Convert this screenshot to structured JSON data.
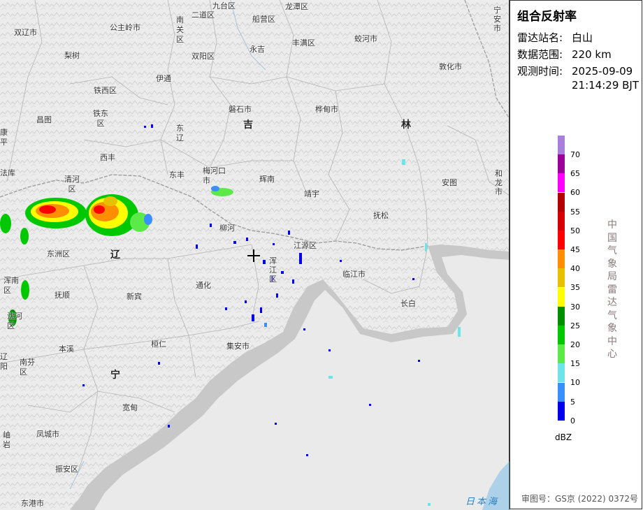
{
  "panel": {
    "title": "组合反射率",
    "station_label": "雷达站名:",
    "station_value": "白山",
    "range_label": "数据范围:",
    "range_value": "220 km",
    "time_label": "观测时间:",
    "time_value_date": "2025-09-09",
    "time_value_clock": "21:14:29 BJT",
    "unit": "dBZ",
    "agency_chars": [
      "中",
      "国",
      "气",
      "象",
      "局",
      "雷",
      "达",
      "气",
      "象",
      "中",
      "心"
    ],
    "approval": "审图号：GS京 (2022) 0372号"
  },
  "legend": {
    "bins": [
      {
        "label": "70",
        "color": "#a97fdc"
      },
      {
        "label": "65",
        "color": "#9b009b"
      },
      {
        "label": "60",
        "color": "#ff00ff"
      },
      {
        "label": "55",
        "color": "#b30000"
      },
      {
        "label": "50",
        "color": "#d60000"
      },
      {
        "label": "45",
        "color": "#ff0000"
      },
      {
        "label": "40",
        "color": "#ff8f00"
      },
      {
        "label": "35",
        "color": "#e7c000"
      },
      {
        "label": "30",
        "color": "#ffff00"
      },
      {
        "label": "25",
        "color": "#008f00"
      },
      {
        "label": "20",
        "color": "#00c800"
      },
      {
        "label": "15",
        "color": "#5cea48"
      },
      {
        "label": "10",
        "color": "#6de4e8"
      },
      {
        "label": "5",
        "color": "#3a8fff"
      },
      {
        "label": "0",
        "color": "#0000ee"
      }
    ]
  },
  "map": {
    "provinces": [
      "吉",
      "林",
      "辽",
      "宁"
    ],
    "sea": "日本海",
    "places": [
      "九台区",
      "龙潭区",
      "宁安市",
      "双辽市",
      "公主岭市",
      "南关区",
      "二道区",
      "船营区",
      "蛟河市",
      "梨树",
      "双阳区",
      "永吉",
      "丰满区",
      "伊通",
      "敦化市",
      "铁西区",
      "铁东区",
      "磐石市",
      "桦甸市",
      "昌图",
      "东辽",
      "康平",
      "西丰",
      "东丰",
      "辉南",
      "安图",
      "和龙市",
      "法库",
      "清河区",
      "梅河口市",
      "靖宇",
      "抚松",
      "东洲区",
      "柳河",
      "江源区",
      "浑江区",
      "临江市",
      "浑南区",
      "通化",
      "新宾",
      "长白",
      "抚顺",
      "沈河区",
      "本溪",
      "桓仁",
      "集安市",
      "南芬区",
      "辽阳",
      "宽甸",
      "凤城市",
      "岫岩",
      "振安区",
      "东港市"
    ],
    "radar_center": "radar-site"
  }
}
